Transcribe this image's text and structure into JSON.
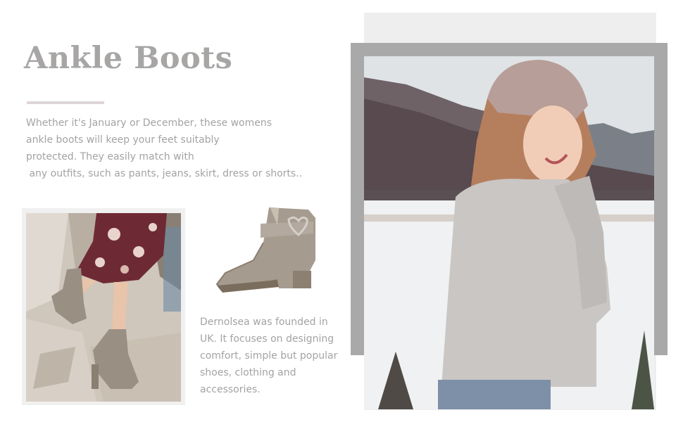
{
  "header": {
    "title": "Ankle Boots"
  },
  "intro": {
    "lines": [
      "Whether it's January or December, these womens",
      "ankle boots will keep your feet suitably",
      "protected. They easily match with",
      " any outfits, such as pants, jeans, skirt, dress or shorts.."
    ]
  },
  "about": {
    "lines": [
      "Dernolsea was founded in",
      "UK. It focuses on designing",
      "comfort, simple but popular",
      "shoes, clothing and",
      "accessories."
    ]
  },
  "colors": {
    "title": "#a8a6a5",
    "body_text": "#a3a3a3",
    "accent_rule": "#ddd6d8",
    "frame": "#a9a9a9",
    "boot": "#9a8f83"
  },
  "images": {
    "legs": "legs-wearing-ankle-boots-photo",
    "boot": "taupe-suede-ankle-boot-heart-buckle",
    "portrait": "woman-in-beanie-snowy-mountains-photo"
  }
}
